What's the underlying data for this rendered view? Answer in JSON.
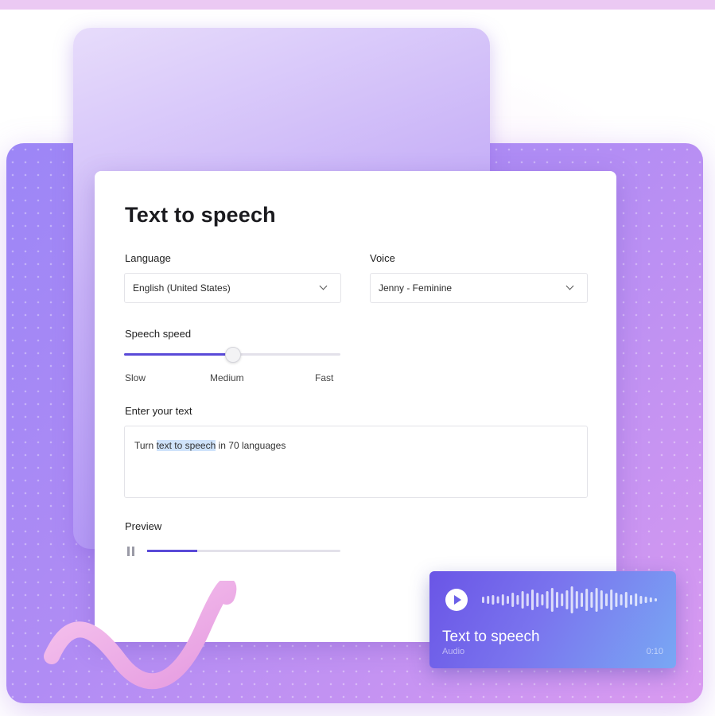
{
  "app": {
    "title": "Text to speech"
  },
  "language": {
    "label": "Language",
    "value": "English (United States)"
  },
  "voice": {
    "label": "Voice",
    "value": "Jenny - Feminine"
  },
  "speed": {
    "label": "Speech speed",
    "ticks": [
      "Slow",
      "Medium",
      "Fast"
    ],
    "level": 0.5
  },
  "text_input": {
    "label": "Enter your text",
    "value_before": "Turn ",
    "value_highlight": "text to speech",
    "value_after": " in 70 languages"
  },
  "preview": {
    "label": "Preview",
    "progress": 0.26
  },
  "audio_card": {
    "title": "Text to speech",
    "subtitle": "Audio",
    "time": "0:10"
  },
  "colors": {
    "accent": "#5a4ad8",
    "panel_gradient_start": "#9c86f6",
    "panel_gradient_end": "#d99af0",
    "audio_gradient_start": "#6a55e6",
    "audio_gradient_end": "#79a8f4",
    "squiggle": "#f3b4e8"
  }
}
